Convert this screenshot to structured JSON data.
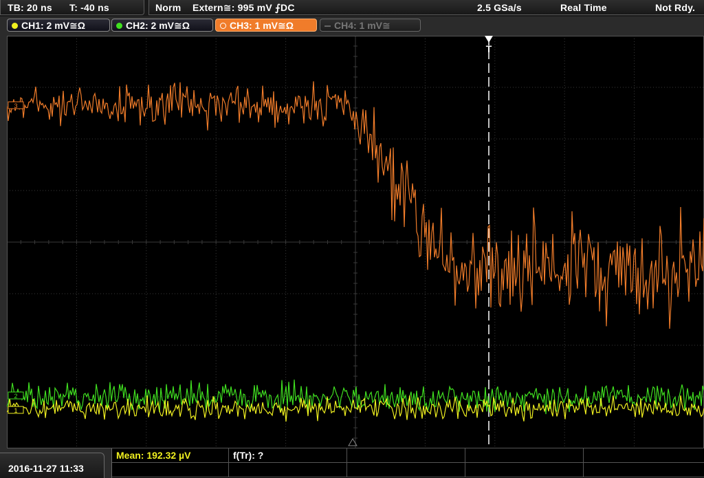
{
  "status": {
    "timebase": "TB: 20 ns",
    "trigger_offset": "T: -40 ns",
    "trigger_mode": "Norm",
    "trigger_source": "Extern≅: 995 mV ⨍DC",
    "sample_rate": "2.5 GSa/s",
    "acq_mode": "Real Time",
    "state": "Not Rdy."
  },
  "channels": [
    {
      "label": "CH1: 2 mV≅Ω",
      "color": "#f0f020",
      "active": true
    },
    {
      "label": "CH2: 2 mV≅Ω",
      "color": "#40e020",
      "active": true
    },
    {
      "label": "CH3: 1 mV≅Ω",
      "color": "#f07c2a",
      "active": true
    },
    {
      "label": "CH4: 1 mV≅",
      "color": "#777777",
      "active": false
    }
  ],
  "plot": {
    "trigger_marker": "T",
    "ref_marker_ch1": "1",
    "ref_marker_ch2": "2",
    "ref_marker_ch3": "3",
    "colors": {
      "ch1": "#f0f020",
      "ch2": "#40e020",
      "ch3": "#f07c2a",
      "grid": "#3a3a3a",
      "trigger_line": "#ffffff"
    }
  },
  "bottom": {
    "datetime": "2016-11-27 11:33",
    "measurements": [
      {
        "label": "Mean: 192.32 µV",
        "color": "#f0f020"
      },
      {
        "label": "f(Tr): ?",
        "color": "#ffffff"
      }
    ]
  }
}
